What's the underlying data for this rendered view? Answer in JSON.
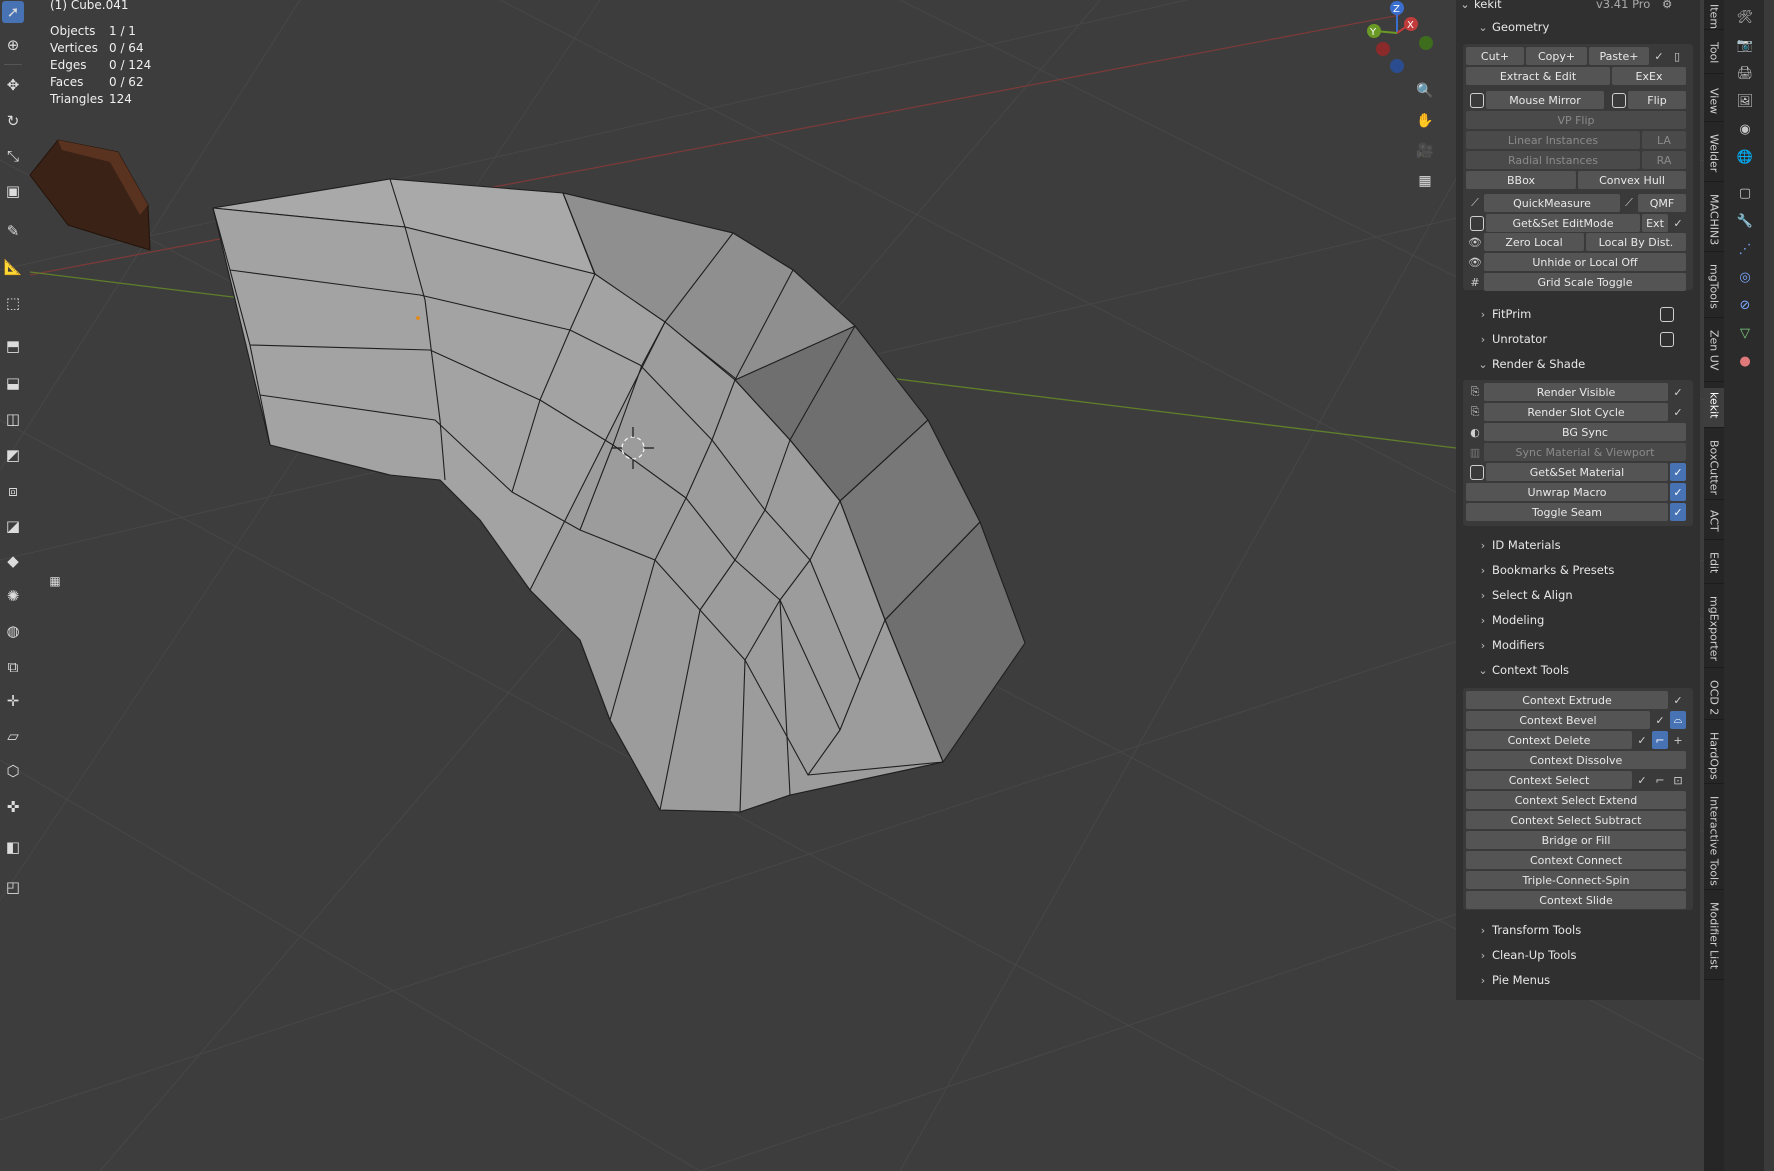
{
  "viewport": {
    "object_title": "(1) Cube.041",
    "stats": [
      {
        "label": "Objects",
        "value": "1 / 1"
      },
      {
        "label": "Vertices",
        "value": "0 / 64"
      },
      {
        "label": "Edges",
        "value": "0 / 124"
      },
      {
        "label": "Faces",
        "value": "0 / 62"
      },
      {
        "label": "Triangles",
        "value": "124"
      }
    ],
    "gizmo": {
      "x": "X",
      "y": "Y",
      "z": "Z"
    }
  },
  "panel": {
    "addon_name": "kekit",
    "version": "v3.41 Pro",
    "sections": {
      "geometry": "Geometry",
      "fitprim": "FitPrim",
      "unrotator": "Unrotator",
      "render_shade": "Render & Shade",
      "id_materials": "ID Materials",
      "bookmarks": "Bookmarks & Presets",
      "select_align": "Select & Align",
      "modeling": "Modeling",
      "modifiers": "Modifiers",
      "context_tools": "Context Tools",
      "transform_tools": "Transform Tools",
      "cleanup_tools": "Clean-Up Tools",
      "pie_menus": "Pie Menus"
    },
    "geometry": {
      "cut": "Cut+",
      "copy": "Copy+",
      "paste": "Paste+",
      "extract_edit": "Extract & Edit",
      "exex": "ExEx",
      "mouse_mirror": "Mouse Mirror",
      "flip": "Flip",
      "vp_flip": "VP Flip",
      "linear_instances": "Linear Instances",
      "la": "LA",
      "radial_instances": "Radial Instances",
      "ra": "RA",
      "bbox": "BBox",
      "convex_hull": "Convex Hull",
      "quickmeasure": "QuickMeasure",
      "qmf": "QMF",
      "getset_editmode": "Get&Set EditMode",
      "ext": "Ext",
      "zero_local": "Zero Local",
      "local_by_dist": "Local By Dist.",
      "unhide_local_off": "Unhide or Local Off",
      "grid_scale_toggle": "Grid Scale Toggle"
    },
    "render_shade": {
      "render_visible": "Render Visible",
      "render_slot_cycle": "Render Slot Cycle",
      "bg_sync": "BG Sync",
      "sync_material_viewport": "Sync Material & Viewport",
      "getset_material": "Get&Set Material",
      "unwrap_macro": "Unwrap Macro",
      "toggle_seam": "Toggle Seam"
    },
    "context_tools": {
      "extrude": "Context Extrude",
      "bevel": "Context Bevel",
      "delete": "Context Delete",
      "dissolve": "Context Dissolve",
      "select": "Context Select",
      "select_extend": "Context Select Extend",
      "select_subtract": "Context Select Subtract",
      "bridge_fill": "Bridge or Fill",
      "connect": "Context Connect",
      "triple_connect_spin": "Triple-Connect-Spin",
      "slide": "Context Slide"
    }
  },
  "tabs": [
    "Item",
    "Tool",
    "View",
    "Welder",
    "MACHIN3",
    "mgTools",
    "Zen UV",
    "kekit",
    "BoxCutter",
    "ACT",
    "Edit",
    "mgExporter",
    "OCD 2",
    "HardOps",
    "Interactive Tools",
    "Modifier List"
  ],
  "active_tab": "kekit",
  "colors": {
    "accent": "#4772b3",
    "panel_bg": "#303030",
    "button": "#545454",
    "viewport_bg": "#3d3d3d",
    "mesh_face": "#a8a8a8",
    "axis_x": "#c23b3b",
    "axis_y": "#6a9a25"
  }
}
